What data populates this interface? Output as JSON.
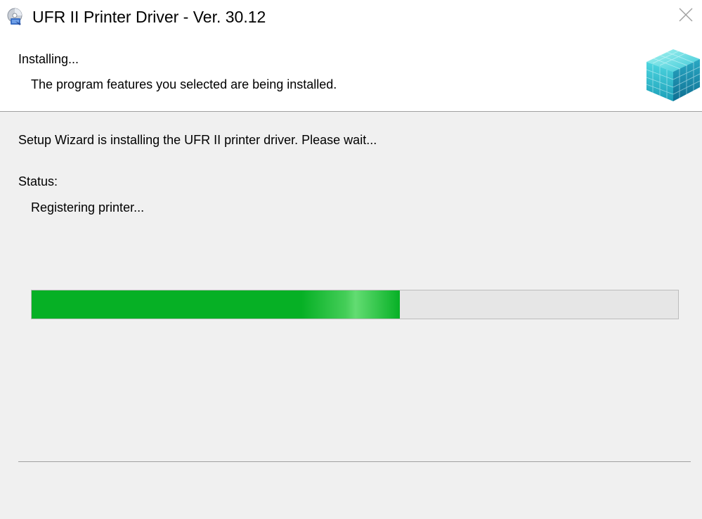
{
  "window": {
    "title": "UFR II Printer Driver - Ver. 30.12",
    "close_icon": "close-icon",
    "app_icon": "installer-disc-icon"
  },
  "header": {
    "title": "Installing...",
    "subtitle": "The program features you selected are being installed.",
    "graphic_icon": "cube-graphic"
  },
  "body": {
    "message": "Setup Wizard is installing the UFR II printer driver. Please wait...",
    "status_label": "Status:",
    "status_value": "Registering printer...",
    "progress_fraction": 0.57
  },
  "colors": {
    "progress_fill": "#06b025",
    "progress_track": "#e6e6e6",
    "background": "#f0f0f0"
  }
}
